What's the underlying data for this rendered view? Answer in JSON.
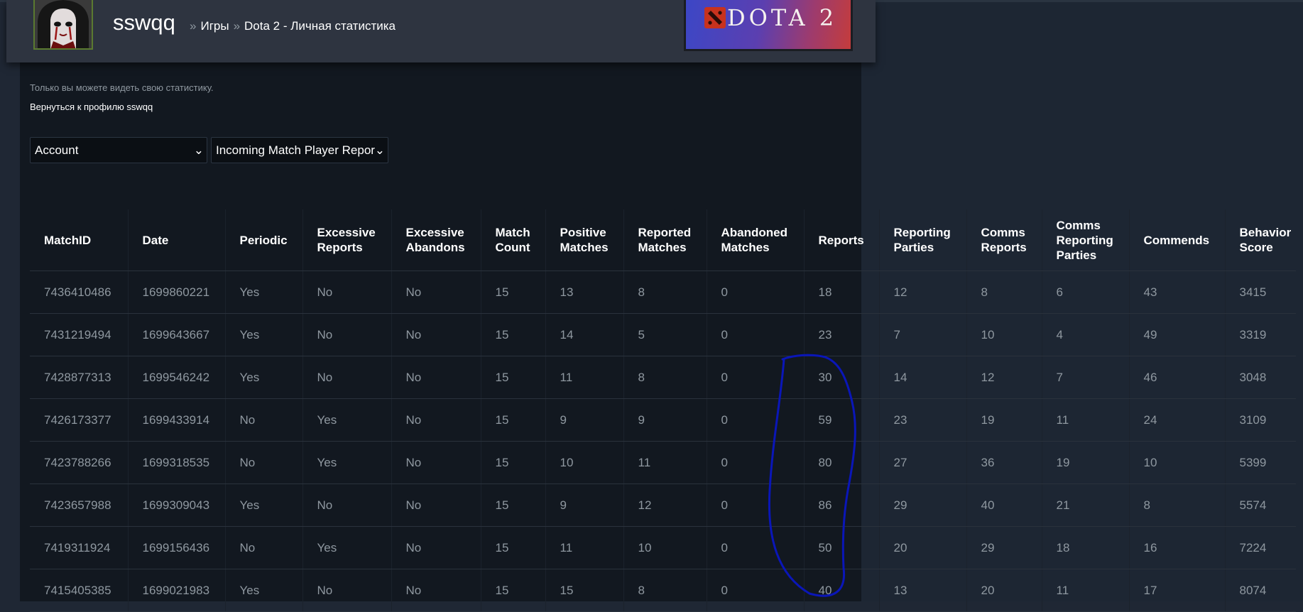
{
  "header": {
    "username": "sswqq",
    "breadcrumb": {
      "separator": "»",
      "games": "Игры",
      "page": "Dota 2 - Личная статистика"
    },
    "banner_text": "DOTA 2"
  },
  "notice": {
    "private_text": "Только вы можете видеть свою статистику.",
    "back_link": "Вернуться к профилю sswqq"
  },
  "filters": {
    "category": "Account",
    "report": "Incoming Match Player Repor",
    "chevron": "⌄"
  },
  "table": {
    "headers": [
      "MatchID",
      "Date",
      "Periodic",
      "Excessive Reports",
      "Excessive Abandons",
      "Match Count",
      "Positive Matches",
      "Reported Matches",
      "Abandoned Matches",
      "Reports",
      "Reporting Parties",
      "Comms Reports",
      "Comms Reporting Parties",
      "Commends",
      "Behavior Score"
    ],
    "rows": [
      [
        "7436410486",
        "1699860221",
        "Yes",
        "No",
        "No",
        "15",
        "13",
        "8",
        "0",
        "18",
        "12",
        "8",
        "6",
        "43",
        "3415"
      ],
      [
        "7431219494",
        "1699643667",
        "Yes",
        "No",
        "No",
        "15",
        "14",
        "5",
        "0",
        "23",
        "7",
        "10",
        "4",
        "49",
        "3319"
      ],
      [
        "7428877313",
        "1699546242",
        "Yes",
        "No",
        "No",
        "15",
        "11",
        "8",
        "0",
        "30",
        "14",
        "12",
        "7",
        "46",
        "3048"
      ],
      [
        "7426173377",
        "1699433914",
        "No",
        "Yes",
        "No",
        "15",
        "9",
        "9",
        "0",
        "59",
        "23",
        "19",
        "11",
        "24",
        "3109"
      ],
      [
        "7423788266",
        "1699318535",
        "No",
        "Yes",
        "No",
        "15",
        "10",
        "11",
        "0",
        "80",
        "27",
        "36",
        "19",
        "10",
        "5399"
      ],
      [
        "7423657988",
        "1699309043",
        "Yes",
        "No",
        "No",
        "15",
        "9",
        "12",
        "0",
        "86",
        "29",
        "40",
        "21",
        "8",
        "5574"
      ],
      [
        "7419311924",
        "1699156436",
        "No",
        "Yes",
        "No",
        "15",
        "11",
        "10",
        "0",
        "50",
        "20",
        "29",
        "18",
        "16",
        "7224"
      ],
      [
        "7415405385",
        "1699021983",
        "Yes",
        "No",
        "No",
        "15",
        "15",
        "8",
        "0",
        "40",
        "13",
        "20",
        "11",
        "17",
        "8074"
      ]
    ]
  },
  "colors": {
    "annotation_stroke": "#0a16b8",
    "header_text": "#ffffff",
    "cell_text": "#8f98a0"
  },
  "icons": {
    "select_chevron": "chevron-down-icon",
    "dota_logo": "dota-logo-icon"
  }
}
